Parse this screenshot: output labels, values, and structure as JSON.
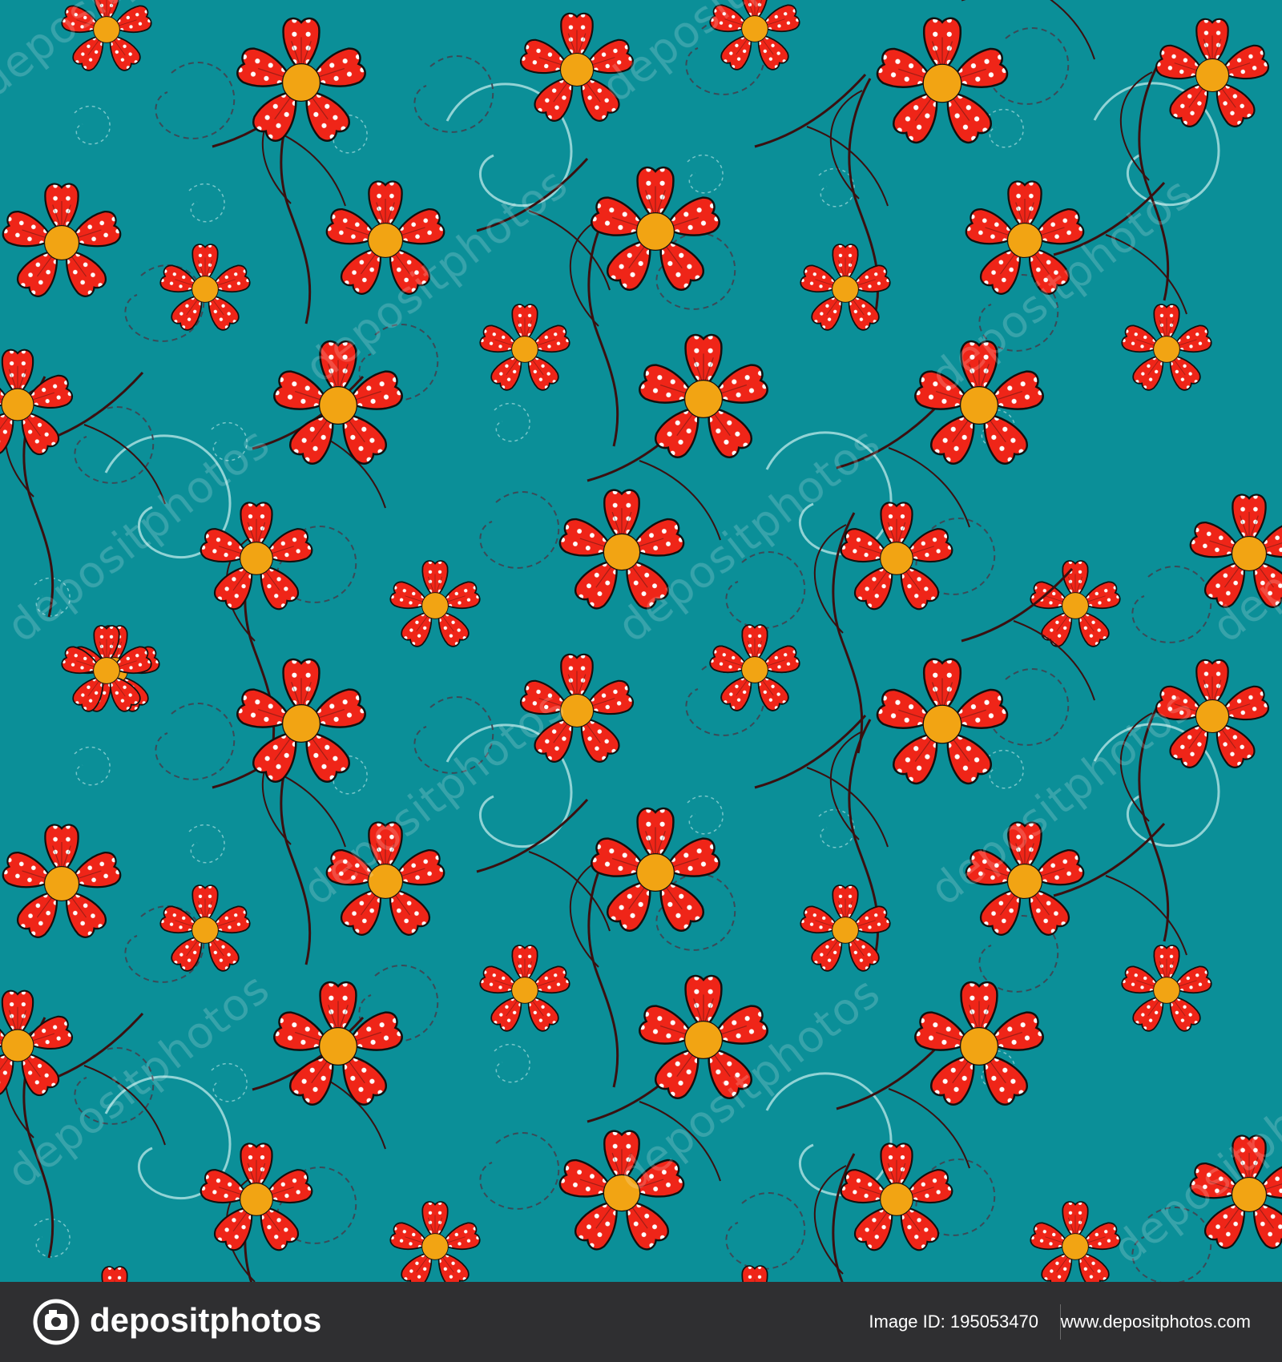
{
  "image": {
    "type": "seamless floral pattern",
    "background_color": "#0b8f98",
    "flower_color": "#ef2518",
    "flower_dot_color": "#ffffff",
    "flower_center_color": "#f2a413",
    "stem_color": "#3a1010",
    "swirl_color": "#bfe9ea",
    "dashed_swirl_color": "#3b4a57",
    "outline_color": "#11100f"
  },
  "watermark": {
    "text": "depositphotos"
  },
  "footer": {
    "brand": "depositphotos",
    "image_id": "Image ID: 195053470",
    "url": "www.depositphotos.com",
    "background_color": "#2f2f31"
  }
}
